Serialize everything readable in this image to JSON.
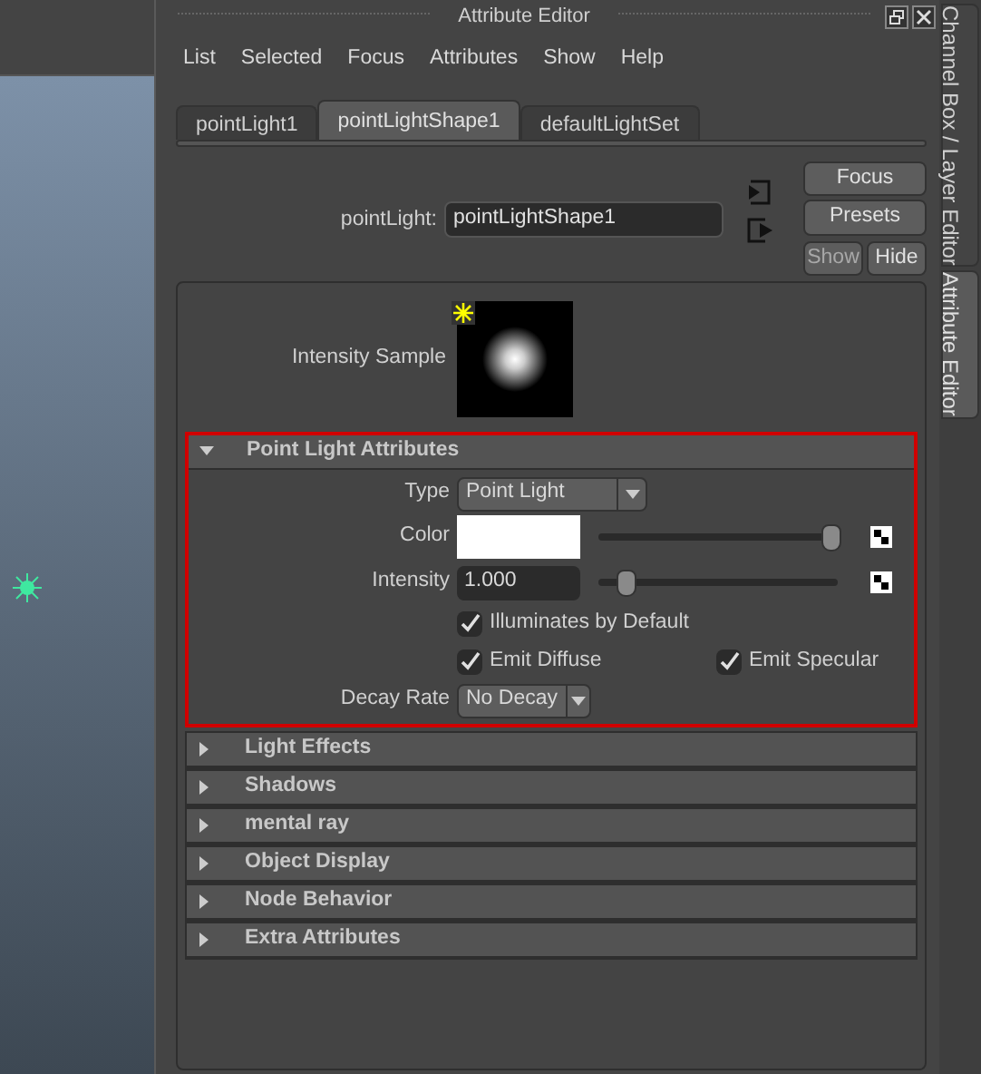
{
  "window": {
    "title": "Attribute Editor"
  },
  "menu": [
    "List",
    "Selected",
    "Focus",
    "Attributes",
    "Show",
    "Help"
  ],
  "tabs": [
    {
      "label": "pointLight1",
      "selected": false
    },
    {
      "label": "pointLightShape1",
      "selected": true
    },
    {
      "label": "defaultLightSet",
      "selected": false
    }
  ],
  "node": {
    "label": "pointLight:",
    "value": "pointLightShape1"
  },
  "buttons": [
    {
      "label": "Focus",
      "disabled": false
    },
    {
      "label": "Presets",
      "disabled": false
    }
  ],
  "small_buttons": [
    {
      "label": "Show",
      "disabled": true
    },
    {
      "label": "Hide",
      "disabled": false
    }
  ],
  "sample": {
    "label": "Intensity Sample"
  },
  "sections": [
    {
      "title": "Point Light Attributes",
      "expanded": true,
      "highlighted": true,
      "attributes": [
        {
          "kind": "dropdown",
          "label": "Type",
          "value": "Point Light"
        },
        {
          "kind": "color",
          "label": "Color",
          "color": "#ffffff",
          "level": 0.97
        },
        {
          "kind": "number",
          "label": "Intensity",
          "value": "1.000",
          "level": 0.11
        },
        {
          "kind": "checks",
          "items": [
            {
              "label": "Illuminates by Default",
              "checked": true
            }
          ]
        },
        {
          "kind": "checks",
          "items": [
            {
              "label": "Emit Diffuse",
              "checked": true
            },
            {
              "label": "Emit Specular",
              "checked": true
            }
          ]
        },
        {
          "kind": "dropdown",
          "label": "Decay Rate",
          "value": "No Decay"
        }
      ]
    },
    {
      "title": "Light Effects",
      "expanded": false,
      "highlighted": false
    },
    {
      "title": "Shadows",
      "expanded": false,
      "highlighted": false
    },
    {
      "title": "mental ray",
      "expanded": false,
      "highlighted": false
    },
    {
      "title": "Object Display",
      "expanded": false,
      "highlighted": false
    },
    {
      "title": "Node Behavior",
      "expanded": false,
      "highlighted": false
    },
    {
      "title": "Extra Attributes",
      "expanded": false,
      "highlighted": false
    }
  ],
  "side_tabs": [
    {
      "label": "Channel Box / Layer Editor",
      "selected": false
    },
    {
      "label": "Attribute Editor",
      "selected": true
    }
  ]
}
